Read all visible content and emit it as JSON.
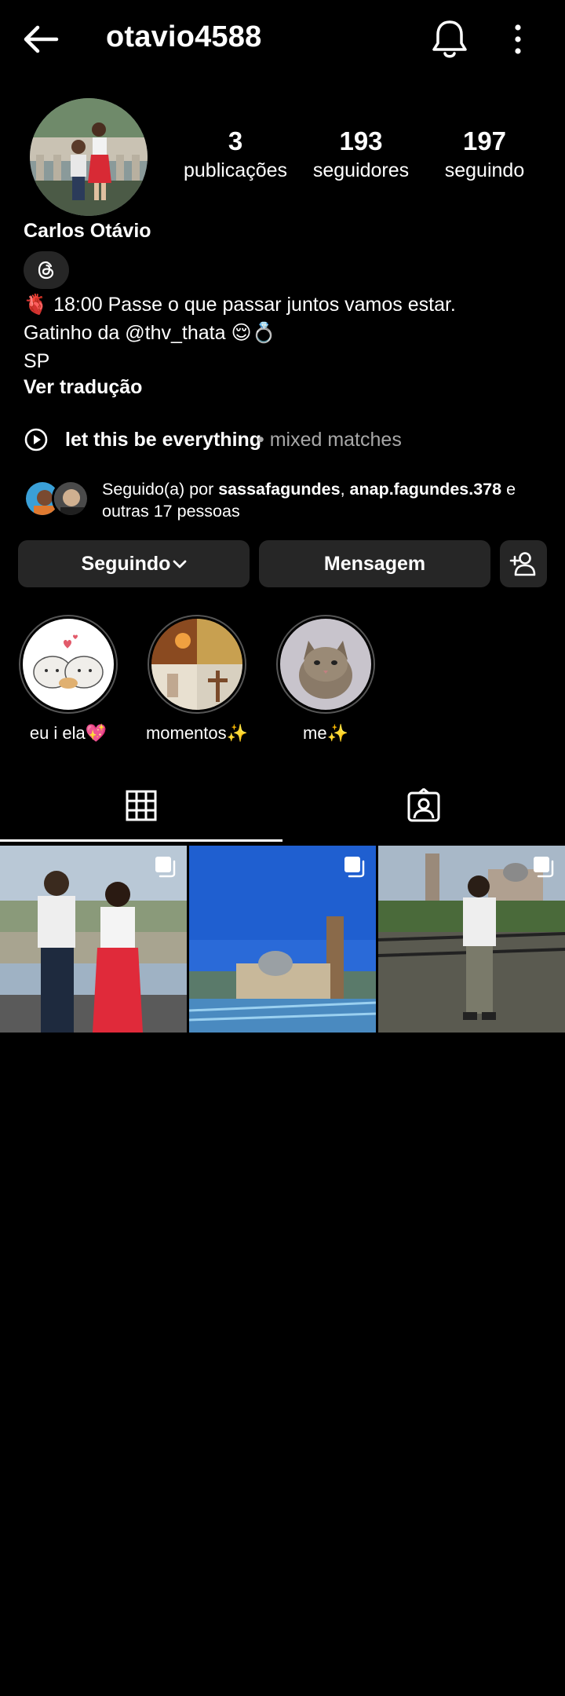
{
  "header": {
    "username": "otavio4588",
    "back_icon": "arrow-left-icon",
    "bell_icon": "bell-icon",
    "more_icon": "more-vertical-icon"
  },
  "profile": {
    "display_name": "Carlos Otávio",
    "stats": [
      {
        "value": "3",
        "label": "publicações"
      },
      {
        "value": "193",
        "label": "seguidores"
      },
      {
        "value": "197",
        "label": "seguindo"
      }
    ],
    "threads_icon": "threads-icon",
    "bio": {
      "line1": "🫀 18:00 Passe o que passar juntos vamos estar.",
      "line2_prefix": "Gatinho da ",
      "line2_mention": "@thv_thata",
      "line2_suffix": " 😌💍",
      "line3": "SP"
    },
    "translate_label": "Ver tradução"
  },
  "music": {
    "song": "let this be everything",
    "separator_artist": "• mixed matches"
  },
  "followed_by": {
    "prefix": "Seguido(a) por ",
    "user1": "sassafagundes",
    "comma": ", ",
    "user2": "anap.fagundes.378",
    "suffix": " e outras 17 pessoas"
  },
  "actions": {
    "following_label": "Seguindo",
    "message_label": "Mensagem",
    "add_user_icon": "add-user-icon"
  },
  "highlights": [
    {
      "label": "eu i ela💖"
    },
    {
      "label": "momentos✨"
    },
    {
      "label": "me✨"
    }
  ],
  "tabs": [
    {
      "icon": "grid-icon",
      "active": true
    },
    {
      "icon": "tagged-icon",
      "active": false
    }
  ],
  "posts": [
    {
      "type": "carousel"
    },
    {
      "type": "carousel"
    },
    {
      "type": "carousel"
    }
  ]
}
